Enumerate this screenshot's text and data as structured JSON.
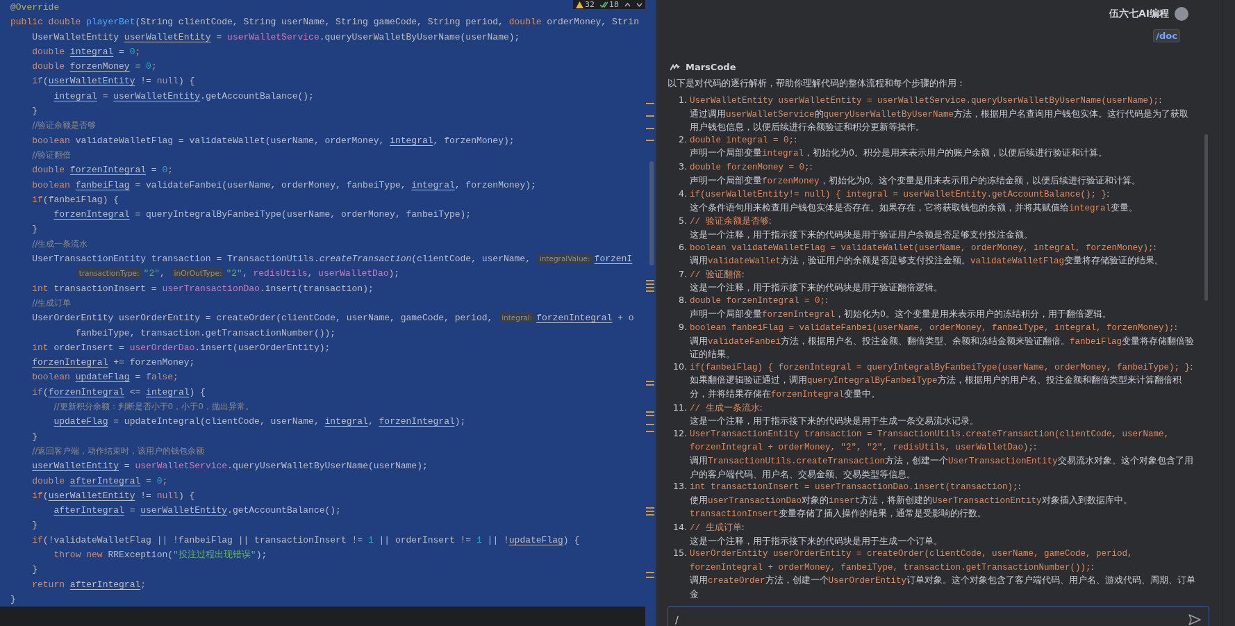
{
  "editor": {
    "selected": true,
    "inspections": {
      "warnings": "32",
      "passed": "18"
    },
    "lines": [
      [
        {
          "kind": "annotation",
          "t": "@Override"
        }
      ],
      [
        {
          "kind": "keyword",
          "t": "public double "
        },
        {
          "kind": "method",
          "t": "playerBet"
        },
        {
          "kind": "plain",
          "t": "(String clientCode, String userName, String gameCode, String period, "
        },
        {
          "kind": "keyword",
          "t": "double "
        },
        {
          "kind": "plain",
          "t": "orderMoney, Strin"
        }
      ],
      [
        {
          "kind": "plain",
          "t": "    UserWalletEntity "
        },
        {
          "kind": "variable",
          "t": "userWalletEntity"
        },
        {
          "kind": "plain",
          "t": " = "
        },
        {
          "kind": "field",
          "t": "userWalletService"
        },
        {
          "kind": "plain",
          "t": ".queryUserWalletByUserName(userName);"
        }
      ],
      [
        {
          "kind": "keyword",
          "t": "    double "
        },
        {
          "kind": "variable",
          "t": "integral"
        },
        {
          "kind": "plain",
          "t": " = "
        },
        {
          "kind": "number",
          "t": "0"
        },
        {
          "kind": "keyword",
          "t": ";"
        }
      ],
      [
        {
          "kind": "keyword",
          "t": "    double "
        },
        {
          "kind": "variable",
          "t": "forzenMoney"
        },
        {
          "kind": "plain",
          "t": " = "
        },
        {
          "kind": "number",
          "t": "0"
        },
        {
          "kind": "keyword",
          "t": ";"
        }
      ],
      [
        {
          "kind": "keyword",
          "t": "    if"
        },
        {
          "kind": "plain",
          "t": "("
        },
        {
          "kind": "variable",
          "t": "userWalletEntity"
        },
        {
          "kind": "plain",
          "t": " != "
        },
        {
          "kind": "keyword",
          "t": "null"
        },
        {
          "kind": "plain",
          "t": ") {"
        }
      ],
      [
        {
          "kind": "variable",
          "t": "        integral"
        },
        {
          "kind": "plain",
          "t": " = "
        },
        {
          "kind": "variable",
          "t": "userWalletEntity"
        },
        {
          "kind": "plain",
          "t": ".getAccountBalance();"
        }
      ],
      [
        {
          "kind": "plain",
          "t": "    }"
        }
      ],
      [
        {
          "kind": "comment",
          "t": "    //验证余额是否够"
        }
      ],
      [
        {
          "kind": "keyword",
          "t": "    boolean "
        },
        {
          "kind": "plain",
          "t": "validateWalletFlag = validateWallet(userName, orderMoney, "
        },
        {
          "kind": "variable",
          "t": "integral"
        },
        {
          "kind": "plain",
          "t": ", forzenMoney);"
        }
      ],
      [
        {
          "kind": "comment",
          "t": "    //验证翻倍"
        }
      ],
      [
        {
          "kind": "keyword",
          "t": "    double "
        },
        {
          "kind": "variable",
          "t": "forzenIntegral"
        },
        {
          "kind": "plain",
          "t": " = "
        },
        {
          "kind": "number",
          "t": "0"
        },
        {
          "kind": "keyword",
          "t": ";"
        }
      ],
      [
        {
          "kind": "keyword",
          "t": "    boolean "
        },
        {
          "kind": "variable",
          "t": "fanbeiFlag"
        },
        {
          "kind": "plain",
          "t": " = validateFanbei(userName, orderMoney, fanbeiType, "
        },
        {
          "kind": "variable",
          "t": "integral"
        },
        {
          "kind": "plain",
          "t": ", forzenMoney);"
        }
      ],
      [
        {
          "kind": "keyword",
          "t": "    if"
        },
        {
          "kind": "plain",
          "t": "(fanbeiFlag) {"
        }
      ],
      [
        {
          "kind": "variable",
          "t": "        forzenIntegral"
        },
        {
          "kind": "plain",
          "t": " = queryIntegralByFanbeiType(userName, orderMoney, fanbeiType);"
        }
      ],
      [
        {
          "kind": "plain",
          "t": "    }"
        }
      ],
      [
        {
          "kind": "comment",
          "t": "    //生成一条流水"
        }
      ],
      [
        {
          "kind": "plain",
          "t": "    UserTransactionEntity transaction = TransactionUtils."
        },
        {
          "kind": "italic",
          "t": "createTransaction"
        },
        {
          "kind": "plain",
          "t": "(clientCode, userName, "
        },
        {
          "kind": "hint",
          "t": "integralValue:"
        },
        {
          "kind": "variable",
          "t": "forzenI"
        }
      ],
      [
        {
          "kind": "hint",
          "t": "            transactionType:"
        },
        {
          "kind": "string",
          "t": "\"2\""
        },
        {
          "kind": "plain",
          "t": ", "
        },
        {
          "kind": "hint",
          "t": "inOrOutType:"
        },
        {
          "kind": "string",
          "t": "\"2\""
        },
        {
          "kind": "plain",
          "t": ", "
        },
        {
          "kind": "field",
          "t": "redisUtils"
        },
        {
          "kind": "plain",
          "t": ", "
        },
        {
          "kind": "field",
          "t": "userWalletDao"
        },
        {
          "kind": "plain",
          "t": ");"
        }
      ],
      [
        {
          "kind": "keyword",
          "t": "    int "
        },
        {
          "kind": "plain",
          "t": "transactionInsert = "
        },
        {
          "kind": "field",
          "t": "userTransactionDao"
        },
        {
          "kind": "plain",
          "t": ".insert(transaction);"
        }
      ],
      [
        {
          "kind": "comment",
          "t": "    //生成订单"
        }
      ],
      [
        {
          "kind": "plain",
          "t": "    UserOrderEntity userOrderEntity = createOrder(clientCode, userName, gameCode, period, "
        },
        {
          "kind": "hint",
          "t": "integral:"
        },
        {
          "kind": "variable",
          "t": "forzenIntegral"
        },
        {
          "kind": "plain",
          "t": " + o"
        }
      ],
      [
        {
          "kind": "plain",
          "t": "            fanbeiType, transaction.getTransactionNumber());"
        }
      ],
      [
        {
          "kind": "keyword",
          "t": "    int "
        },
        {
          "kind": "plain",
          "t": "orderInsert = "
        },
        {
          "kind": "field",
          "t": "userOrderDao"
        },
        {
          "kind": "plain",
          "t": ".insert(userOrderEntity);"
        }
      ],
      [
        {
          "kind": "variable",
          "t": "    forzenIntegral"
        },
        {
          "kind": "plain",
          "t": " += forzenMoney;"
        }
      ],
      [
        {
          "kind": "keyword",
          "t": "    boolean "
        },
        {
          "kind": "variable",
          "t": "updateFlag"
        },
        {
          "kind": "plain",
          "t": " = "
        },
        {
          "kind": "keyword",
          "t": "false;"
        }
      ],
      [
        {
          "kind": "keyword",
          "t": "    if"
        },
        {
          "kind": "plain",
          "t": "("
        },
        {
          "kind": "variable",
          "t": "forzenIntegral"
        },
        {
          "kind": "plain",
          "t": " <= "
        },
        {
          "kind": "variable",
          "t": "integral"
        },
        {
          "kind": "plain",
          "t": ") {"
        }
      ],
      [
        {
          "kind": "comment",
          "t": "        //更新积分余额：判断是否小于0，小于0，抛出异常。"
        }
      ],
      [
        {
          "kind": "variable",
          "t": "        updateFlag"
        },
        {
          "kind": "plain",
          "t": " = updateIntegral(clientCode, userName, "
        },
        {
          "kind": "variable",
          "t": "integral"
        },
        {
          "kind": "plain",
          "t": ", "
        },
        {
          "kind": "variable",
          "t": "forzenIntegral"
        },
        {
          "kind": "plain",
          "t": ");"
        }
      ],
      [
        {
          "kind": "plain",
          "t": "    }"
        }
      ],
      [
        {
          "kind": "comment",
          "t": "    //返回客户端，动作结束时，该用户的钱包余额"
        }
      ],
      [
        {
          "kind": "variable",
          "t": "    userWalletEntity"
        },
        {
          "kind": "plain",
          "t": " = "
        },
        {
          "kind": "field",
          "t": "userWalletService"
        },
        {
          "kind": "plain",
          "t": ".queryUserWalletByUserName(userName);"
        }
      ],
      [
        {
          "kind": "keyword",
          "t": "    double "
        },
        {
          "kind": "variable",
          "t": "afterIntegral"
        },
        {
          "kind": "plain",
          "t": " = "
        },
        {
          "kind": "number",
          "t": "0"
        },
        {
          "kind": "keyword",
          "t": ";"
        }
      ],
      [
        {
          "kind": "keyword",
          "t": "    if"
        },
        {
          "kind": "plain",
          "t": "("
        },
        {
          "kind": "variable",
          "t": "userWalletEntity"
        },
        {
          "kind": "plain",
          "t": " != "
        },
        {
          "kind": "keyword",
          "t": "null"
        },
        {
          "kind": "plain",
          "t": ") {"
        }
      ],
      [
        {
          "kind": "variable",
          "t": "        afterIntegral"
        },
        {
          "kind": "plain",
          "t": " = "
        },
        {
          "kind": "variable",
          "t": "userWalletEntity"
        },
        {
          "kind": "plain",
          "t": ".getAccountBalance();"
        }
      ],
      [
        {
          "kind": "plain",
          "t": "    }"
        }
      ],
      [
        {
          "kind": "keyword",
          "t": "    if"
        },
        {
          "kind": "plain",
          "t": "(!validateWalletFlag || !fanbeiFlag || transactionInsert != "
        },
        {
          "kind": "number",
          "t": "1"
        },
        {
          "kind": "plain",
          "t": " || orderInsert != "
        },
        {
          "kind": "number",
          "t": "1"
        },
        {
          "kind": "plain",
          "t": " || !"
        },
        {
          "kind": "variable",
          "t": "updateFlag"
        },
        {
          "kind": "plain",
          "t": ") {"
        }
      ],
      [
        {
          "kind": "keyword",
          "t": "        throw new "
        },
        {
          "kind": "plain",
          "t": "RRException("
        },
        {
          "kind": "string",
          "t": "\"投注过程出现错误\""
        },
        {
          "kind": "plain",
          "t": ");"
        }
      ],
      [
        {
          "kind": "plain",
          "t": "    }"
        }
      ],
      [
        {
          "kind": "keyword",
          "t": "    return "
        },
        {
          "kind": "variable",
          "t": "afterIntegral"
        },
        {
          "kind": "keyword",
          "t": ";"
        }
      ],
      [
        {
          "kind": "plain",
          "t": "}"
        }
      ]
    ]
  },
  "chat": {
    "user": "伍六七AI编程",
    "command": "/doc",
    "assistant": "MarsCode",
    "intro": "以下是对代码的逐行解析，帮助你理解代码的整体流程和每个步骤的作用：",
    "items": [
      {
        "number": "1.",
        "head": [
          {
            "kind": "code",
            "t": "UserWalletEntity userWalletEntity = userWalletService.queryUserWalletByUserName(userName);"
          },
          {
            "kind": "text",
            "t": ":"
          }
        ],
        "desc": [
          {
            "kind": "text",
            "t": "通过调用"
          },
          {
            "kind": "code",
            "t": "userWalletService"
          },
          {
            "kind": "text",
            "t": "的"
          },
          {
            "kind": "code",
            "t": "queryUserWalletByUserName"
          },
          {
            "kind": "text",
            "t": "方法，根据用户名查询用户钱包实体。这行代码是为了获取用户钱包信息，以便后续进行余额验证和积分更新等操作。"
          }
        ]
      },
      {
        "number": "2.",
        "head": [
          {
            "kind": "code",
            "t": "double integral = 0;"
          },
          {
            "kind": "text",
            "t": ":"
          }
        ],
        "desc": [
          {
            "kind": "text",
            "t": "声明一个局部变量"
          },
          {
            "kind": "code",
            "t": "integral"
          },
          {
            "kind": "text",
            "t": "，初始化为0。积分是用来表示用户的账户余额，以便后续进行验证和计算。"
          }
        ]
      },
      {
        "number": "3.",
        "head": [
          {
            "kind": "code",
            "t": "double forzenMoney = 0;"
          },
          {
            "kind": "text",
            "t": ":"
          }
        ],
        "desc": [
          {
            "kind": "text",
            "t": "声明一个局部变量"
          },
          {
            "kind": "code",
            "t": "forzenMoney"
          },
          {
            "kind": "text",
            "t": "，初始化为0。这个变量是用来表示用户的冻结金额，以便后续进行验证和计算。"
          }
        ]
      },
      {
        "number": "4.",
        "head": [
          {
            "kind": "code",
            "t": "if(userWalletEntity!= null) { integral = userWalletEntity.getAccountBalance(); }"
          },
          {
            "kind": "text",
            "t": ":"
          }
        ],
        "desc": [
          {
            "kind": "text",
            "t": "这个条件语句用来检查用户钱包实体是否存在。如果存在，它将获取钱包的余额，并将其赋值给"
          },
          {
            "kind": "code",
            "t": "integral"
          },
          {
            "kind": "text",
            "t": "变量。"
          }
        ]
      },
      {
        "number": "5.",
        "head": [
          {
            "kind": "code",
            "t": "// 验证余额是否够"
          },
          {
            "kind": "text",
            "t": ":"
          }
        ],
        "desc": [
          {
            "kind": "text",
            "t": "这是一个注释，用于指示接下来的代码块是用于验证用户余额是否足够支付投注金额。"
          }
        ]
      },
      {
        "number": "6.",
        "head": [
          {
            "kind": "code",
            "t": "boolean validateWalletFlag = validateWallet(userName, orderMoney, integral, forzenMoney);"
          },
          {
            "kind": "text",
            "t": ":"
          }
        ],
        "desc": [
          {
            "kind": "text",
            "t": "调用"
          },
          {
            "kind": "code",
            "t": "validateWallet"
          },
          {
            "kind": "text",
            "t": "方法，验证用户的余额是否足够支付投注金额。"
          },
          {
            "kind": "code",
            "t": "validateWalletFlag"
          },
          {
            "kind": "text",
            "t": "变量将存储验证的结果。"
          }
        ]
      },
      {
        "number": "7.",
        "head": [
          {
            "kind": "code",
            "t": "// 验证翻倍"
          },
          {
            "kind": "text",
            "t": ":"
          }
        ],
        "desc": [
          {
            "kind": "text",
            "t": "这是一个注释，用于指示接下来的代码块是用于验证翻倍逻辑。"
          }
        ]
      },
      {
        "number": "8.",
        "head": [
          {
            "kind": "code",
            "t": "double forzenIntegral = 0;"
          },
          {
            "kind": "text",
            "t": ":"
          }
        ],
        "desc": [
          {
            "kind": "text",
            "t": "声明一个局部变量"
          },
          {
            "kind": "code",
            "t": "forzenIntegral"
          },
          {
            "kind": "text",
            "t": "，初始化为0。这个变量是用来表示用户的冻结积分，用于翻倍逻辑。"
          }
        ]
      },
      {
        "number": "9.",
        "head": [
          {
            "kind": "code",
            "t": "boolean fanbeiFlag = validateFanbei(userName, orderMoney, fanbeiType, integral, forzenMoney);"
          },
          {
            "kind": "text",
            "t": ":"
          }
        ],
        "desc": [
          {
            "kind": "text",
            "t": "调用"
          },
          {
            "kind": "code",
            "t": "validateFanbei"
          },
          {
            "kind": "text",
            "t": "方法，根据用户名、投注金额、翻倍类型、余额和冻结金额来验证翻倍。"
          },
          {
            "kind": "code",
            "t": "fanbeiFlag"
          },
          {
            "kind": "text",
            "t": "变量将存储翻倍验证的结果。"
          }
        ]
      },
      {
        "number": "10.",
        "head": [
          {
            "kind": "code",
            "t": "if(fanbeiFlag) { forzenIntegral = queryIntegralByFanbeiType(userName, orderMoney, fanbeiType); }"
          },
          {
            "kind": "text",
            "t": ":"
          }
        ],
        "desc": [
          {
            "kind": "text",
            "t": "如果翻倍逻辑验证通过，调用"
          },
          {
            "kind": "code",
            "t": "queryIntegralByFanbeiType"
          },
          {
            "kind": "text",
            "t": "方法，根据用户的用户名、投注金额和翻倍类型来计算翻倍积分，并将结果存储在"
          },
          {
            "kind": "code",
            "t": "forzenIntegral"
          },
          {
            "kind": "text",
            "t": "变量中。"
          }
        ]
      },
      {
        "number": "11.",
        "head": [
          {
            "kind": "code",
            "t": "// 生成一条流水"
          },
          {
            "kind": "text",
            "t": ":"
          }
        ],
        "desc": [
          {
            "kind": "text",
            "t": "这是一个注释，用于指示接下来的代码块是用于生成一条交易流水记录。"
          }
        ]
      },
      {
        "number": "12.",
        "head": [
          {
            "kind": "code",
            "t": "UserTransactionEntity transaction = TransactionUtils.createTransaction(clientCode, userName, forzenIntegral + orderMoney, \"2\", \"2\", redisUtils, userWalletDao);"
          },
          {
            "kind": "text",
            "t": ":"
          }
        ],
        "desc": [
          {
            "kind": "text",
            "t": "调用"
          },
          {
            "kind": "code",
            "t": "TransactionUtils.createTransaction"
          },
          {
            "kind": "text",
            "t": "方法，创建一个"
          },
          {
            "kind": "code",
            "t": "UserTransactionEntity"
          },
          {
            "kind": "text",
            "t": "交易流水对象。这个对象包含了用户的客户端代码、用户名、交易金额、交易类型等信息。"
          }
        ]
      },
      {
        "number": "13.",
        "head": [
          {
            "kind": "code",
            "t": "int transactionInsert = userTransactionDao.insert(transaction);"
          },
          {
            "kind": "text",
            "t": ":"
          }
        ],
        "desc": [
          {
            "kind": "text",
            "t": "使用"
          },
          {
            "kind": "code",
            "t": "userTransactionDao"
          },
          {
            "kind": "text",
            "t": "对象的"
          },
          {
            "kind": "code",
            "t": "insert"
          },
          {
            "kind": "text",
            "t": "方法，将新创建的"
          },
          {
            "kind": "code",
            "t": "UserTransactionEntity"
          },
          {
            "kind": "text",
            "t": "对象插入到数据库中。"
          },
          {
            "kind": "code",
            "t": "transactionInsert"
          },
          {
            "kind": "text",
            "t": "变量存储了插入操作的结果，通常是受影响的行数。"
          }
        ]
      },
      {
        "number": "14.",
        "head": [
          {
            "kind": "code",
            "t": "// 生成订单"
          },
          {
            "kind": "text",
            "t": ":"
          }
        ],
        "desc": [
          {
            "kind": "text",
            "t": "这是一个注释，用于指示接下来的代码块是用于生成一个订单。"
          }
        ]
      },
      {
        "number": "15.",
        "head": [
          {
            "kind": "code",
            "t": "UserOrderEntity userOrderEntity = createOrder(clientCode, userName, gameCode, period, forzenIntegral + orderMoney, fanbeiType, transaction.getTransactionNumber());"
          },
          {
            "kind": "text",
            "t": ":"
          }
        ],
        "desc": [
          {
            "kind": "text",
            "t": "调用"
          },
          {
            "kind": "code",
            "t": "createOrder"
          },
          {
            "kind": "text",
            "t": "方法，创建一个"
          },
          {
            "kind": "code",
            "t": "UserOrderEntity"
          },
          {
            "kind": "text",
            "t": "订单对象。这个对象包含了客户端代码、用户名、游戏代码、周期、订单金"
          }
        ]
      }
    ],
    "input": {
      "value": "/"
    }
  }
}
